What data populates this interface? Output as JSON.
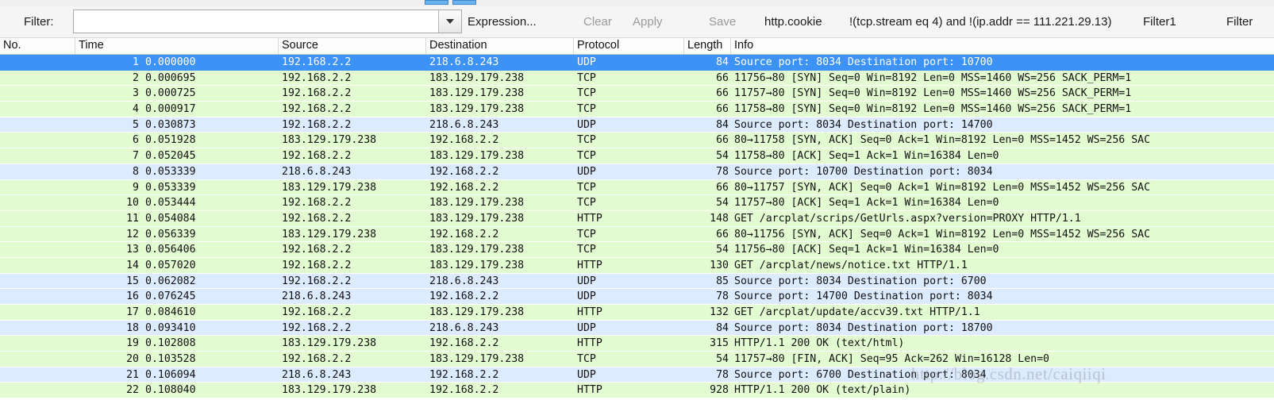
{
  "toolbar": {
    "filter_label": "Filter:",
    "filter_value": "",
    "filter_placeholder": "",
    "dropdown_icon": "chevron-down-icon",
    "expression_label": "Expression...",
    "clear_label": "Clear",
    "apply_label": "Apply",
    "save_label": "Save",
    "bookmark_1": "http.cookie",
    "bookmark_2": "!(tcp.stream eq 4) and !(ip.addr == 111.221.29.13)",
    "bookmark_3": "Filter1",
    "bookmark_4": "Filter"
  },
  "columns": {
    "no": "No.",
    "time": "Time",
    "source": "Source",
    "destination": "Destination",
    "protocol": "Protocol",
    "length": "Length",
    "info": "Info"
  },
  "colors": {
    "selected_row": "#3d93f5",
    "tcp_row": "#e3fbd0",
    "udp_row": "#dcebff",
    "http_row": "#e3fbd0",
    "filter_bar": "#f5f5f5"
  },
  "watermark": "http://blog.csdn.net/caiqiiqi",
  "packets": [
    {
      "no": "1",
      "time": "0.000000",
      "source": "192.168.2.2",
      "destination": "218.6.8.243",
      "protocol": "UDP",
      "length": "84",
      "info": "Source port: 8034   Destination port: 10700",
      "style": "sel",
      "selected": true
    },
    {
      "no": "2",
      "time": "0.000695",
      "source": "192.168.2.2",
      "destination": "183.129.179.238",
      "protocol": "TCP",
      "length": "66",
      "info": "11756→80 [SYN] Seq=0 Win=8192 Len=0 MSS=1460 WS=256 SACK_PERM=1",
      "style": "tcp",
      "selected": false
    },
    {
      "no": "3",
      "time": "0.000725",
      "source": "192.168.2.2",
      "destination": "183.129.179.238",
      "protocol": "TCP",
      "length": "66",
      "info": "11757→80 [SYN] Seq=0 Win=8192 Len=0 MSS=1460 WS=256 SACK_PERM=1",
      "style": "tcp",
      "selected": false
    },
    {
      "no": "4",
      "time": "0.000917",
      "source": "192.168.2.2",
      "destination": "183.129.179.238",
      "protocol": "TCP",
      "length": "66",
      "info": "11758→80 [SYN] Seq=0 Win=8192 Len=0 MSS=1460 WS=256 SACK_PERM=1",
      "style": "tcp",
      "selected": false
    },
    {
      "no": "5",
      "time": "0.030873",
      "source": "192.168.2.2",
      "destination": "218.6.8.243",
      "protocol": "UDP",
      "length": "84",
      "info": "Source port: 8034   Destination port: 14700",
      "style": "udp",
      "selected": false
    },
    {
      "no": "6",
      "time": "0.051928",
      "source": "183.129.179.238",
      "destination": "192.168.2.2",
      "protocol": "TCP",
      "length": "66",
      "info": "80→11758 [SYN, ACK] Seq=0 Ack=1 Win=8192 Len=0 MSS=1452 WS=256 SAC",
      "style": "tcp",
      "selected": false
    },
    {
      "no": "7",
      "time": "0.052045",
      "source": "192.168.2.2",
      "destination": "183.129.179.238",
      "protocol": "TCP",
      "length": "54",
      "info": "11758→80 [ACK] Seq=1 Ack=1 Win=16384 Len=0",
      "style": "tcp",
      "selected": false
    },
    {
      "no": "8",
      "time": "0.053339",
      "source": "218.6.8.243",
      "destination": "192.168.2.2",
      "protocol": "UDP",
      "length": "78",
      "info": "Source port: 10700   Destination port: 8034",
      "style": "udp",
      "selected": false
    },
    {
      "no": "9",
      "time": "0.053339",
      "source": "183.129.179.238",
      "destination": "192.168.2.2",
      "protocol": "TCP",
      "length": "66",
      "info": "80→11757 [SYN, ACK] Seq=0 Ack=1 Win=8192 Len=0 MSS=1452 WS=256 SAC",
      "style": "tcp",
      "selected": false
    },
    {
      "no": "10",
      "time": "0.053444",
      "source": "192.168.2.2",
      "destination": "183.129.179.238",
      "protocol": "TCP",
      "length": "54",
      "info": "11757→80 [ACK] Seq=1 Ack=1 Win=16384 Len=0",
      "style": "tcp",
      "selected": false
    },
    {
      "no": "11",
      "time": "0.054084",
      "source": "192.168.2.2",
      "destination": "183.129.179.238",
      "protocol": "HTTP",
      "length": "148",
      "info": "GET /arcplat/scrips/GetUrls.aspx?version=PROXY HTTP/1.1",
      "style": "http",
      "selected": false
    },
    {
      "no": "12",
      "time": "0.056339",
      "source": "183.129.179.238",
      "destination": "192.168.2.2",
      "protocol": "TCP",
      "length": "66",
      "info": "80→11756 [SYN, ACK] Seq=0 Ack=1 Win=8192 Len=0 MSS=1452 WS=256 SAC",
      "style": "tcp",
      "selected": false
    },
    {
      "no": "13",
      "time": "0.056406",
      "source": "192.168.2.2",
      "destination": "183.129.179.238",
      "protocol": "TCP",
      "length": "54",
      "info": "11756→80 [ACK] Seq=1 Ack=1 Win=16384 Len=0",
      "style": "tcp",
      "selected": false
    },
    {
      "no": "14",
      "time": "0.057020",
      "source": "192.168.2.2",
      "destination": "183.129.179.238",
      "protocol": "HTTP",
      "length": "130",
      "info": "GET /arcplat/news/notice.txt HTTP/1.1",
      "style": "http",
      "selected": false
    },
    {
      "no": "15",
      "time": "0.062082",
      "source": "192.168.2.2",
      "destination": "218.6.8.243",
      "protocol": "UDP",
      "length": "85",
      "info": "Source port: 8034   Destination port: 6700",
      "style": "udp",
      "selected": false
    },
    {
      "no": "16",
      "time": "0.076245",
      "source": "218.6.8.243",
      "destination": "192.168.2.2",
      "protocol": "UDP",
      "length": "78",
      "info": "Source port: 14700   Destination port: 8034",
      "style": "udp",
      "selected": false
    },
    {
      "no": "17",
      "time": "0.084610",
      "source": "192.168.2.2",
      "destination": "183.129.179.238",
      "protocol": "HTTP",
      "length": "132",
      "info": "GET /arcplat/update/accv39.txt HTTP/1.1",
      "style": "http",
      "selected": false
    },
    {
      "no": "18",
      "time": "0.093410",
      "source": "192.168.2.2",
      "destination": "218.6.8.243",
      "protocol": "UDP",
      "length": "84",
      "info": "Source port: 8034   Destination port: 18700",
      "style": "udp",
      "selected": false
    },
    {
      "no": "19",
      "time": "0.102808",
      "source": "183.129.179.238",
      "destination": "192.168.2.2",
      "protocol": "HTTP",
      "length": "315",
      "info": "HTTP/1.1 200 OK  (text/html)",
      "style": "http",
      "selected": false
    },
    {
      "no": "20",
      "time": "0.103528",
      "source": "192.168.2.2",
      "destination": "183.129.179.238",
      "protocol": "TCP",
      "length": "54",
      "info": "11757→80 [FIN, ACK] Seq=95 Ack=262 Win=16128 Len=0",
      "style": "tcp",
      "selected": false
    },
    {
      "no": "21",
      "time": "0.106094",
      "source": "218.6.8.243",
      "destination": "192.168.2.2",
      "protocol": "UDP",
      "length": "78",
      "info": "Source port: 6700   Destination port: 8034",
      "style": "udp",
      "selected": false
    },
    {
      "no": "22",
      "time": "0.108040",
      "source": "183.129.179.238",
      "destination": "192.168.2.2",
      "protocol": "HTTP",
      "length": "928",
      "info": "HTTP/1.1 200 OK  (text/plain)",
      "style": "http",
      "selected": false
    }
  ]
}
